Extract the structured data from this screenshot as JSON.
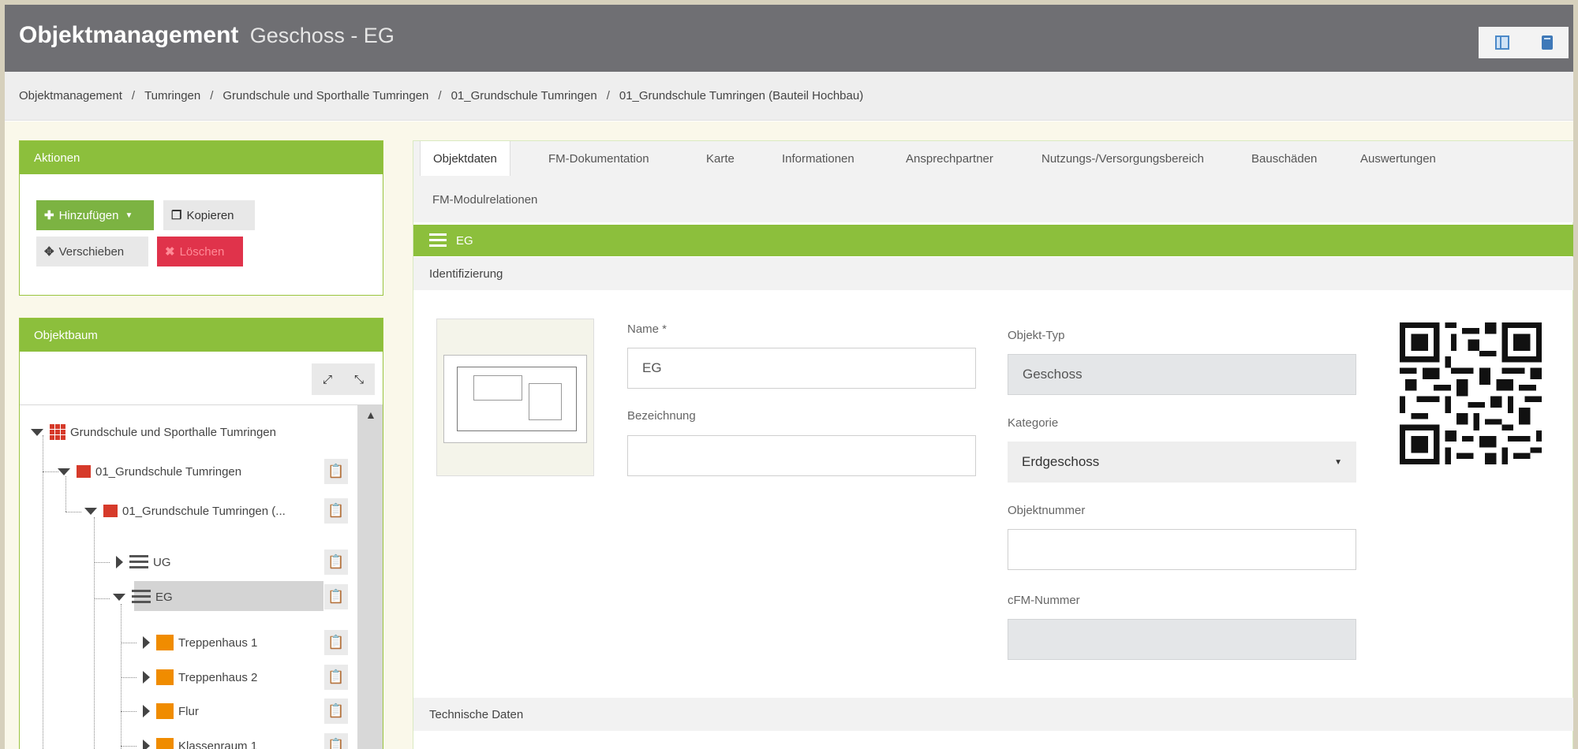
{
  "header": {
    "title": "Objektmanagement",
    "subtitle": "Geschoss - EG",
    "icons": [
      "grid-view-icon",
      "book-icon"
    ]
  },
  "breadcrumb": [
    "Objektmanagement",
    "Tumringen",
    "Grundschule und Sporthalle Tumringen",
    "01_Grundschule Tumringen",
    "01_Grundschule Tumringen (Bauteil Hochbau)"
  ],
  "breadcrumb_separator": "/",
  "actions": {
    "title": "Aktionen",
    "add": "Hinzufügen",
    "copy": "Kopieren",
    "move": "Verschieben",
    "delete": "Löschen"
  },
  "tree": {
    "title": "Objektbaum",
    "nodes": [
      {
        "label": "Grundschule und Sporthalle Tumringen",
        "icon": "building-complex-icon"
      },
      {
        "label": "01_Grundschule Tumringen",
        "icon": "building-icon"
      },
      {
        "label": "01_Grundschule Tumringen (...",
        "icon": "building-part-icon"
      },
      {
        "label": "UG",
        "icon": "floor-icon"
      },
      {
        "label": "EG",
        "icon": "floor-icon",
        "selected": true
      },
      {
        "label": "Treppenhaus 1",
        "icon": "room-icon"
      },
      {
        "label": "Treppenhaus 2",
        "icon": "room-icon"
      },
      {
        "label": "Flur",
        "icon": "room-icon"
      },
      {
        "label": "Klassenraum 1",
        "icon": "room-icon"
      }
    ]
  },
  "tabs": {
    "row1": [
      "Objektdaten",
      "FM-Dokumentation",
      "Karte",
      "Informationen",
      "Ansprechpartner",
      "Nutzungs-/Versorgungsbereich",
      "Bauschäden",
      "Auswertungen"
    ],
    "row2": [
      "FM-Modulrelationen"
    ],
    "active": "Objektdaten"
  },
  "section": {
    "title": "EG",
    "identification": "Identifizierung",
    "technical": "Technische Daten"
  },
  "form": {
    "name_label": "Name *",
    "name_value": "EG",
    "designation_label": "Bezeichnung",
    "designation_value": "",
    "object_type_label": "Objekt-Typ",
    "object_type_value": "Geschoss",
    "category_label": "Kategorie",
    "category_value": "Erdgeschoss",
    "object_number_label": "Objektnummer",
    "object_number_value": "",
    "cfm_number_label": "cFM-Nummer",
    "cfm_number_value": ""
  },
  "colors": {
    "header_bg": "#6f6f73",
    "accent_green": "#8cbf3c",
    "add_button": "#7cb342",
    "delete_button": "#e0334b",
    "tree_icon_red": "#d63a2a",
    "tree_icon_orange": "#f08c00"
  }
}
